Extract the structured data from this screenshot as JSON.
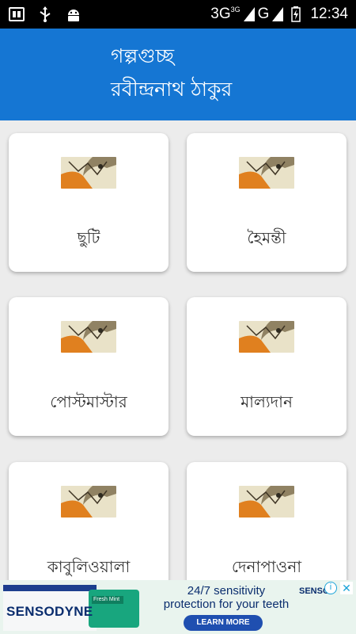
{
  "status_bar": {
    "icons": [
      "sim-card-icon",
      "usb-icon",
      "android-icon"
    ],
    "network_1": "3G",
    "network_1_sup": "3G",
    "network_2": "G",
    "time": "12:34"
  },
  "header": {
    "title": "গল্পগুচ্ছ",
    "subtitle": "রবীন্দ্রনাথ ঠাকুর",
    "color": "#1576d3"
  },
  "stories": [
    {
      "title": "ছুটি"
    },
    {
      "title": "হৈমন্তী"
    },
    {
      "title": "পোস্টমাস্টার"
    },
    {
      "title": "মাল্যদান"
    },
    {
      "title": "কাবুলিওয়ালা"
    },
    {
      "title": "দেনাপাওনা"
    }
  ],
  "ad": {
    "brand": "SENSODYNE",
    "tube_label": "Fresh Mint",
    "line1": "24/7 sensitivity",
    "line2": "protection for your teeth",
    "cta": "LEARN MORE",
    "brand_small": "SENSO",
    "info_symbol": "i",
    "close_symbol": "✕"
  }
}
